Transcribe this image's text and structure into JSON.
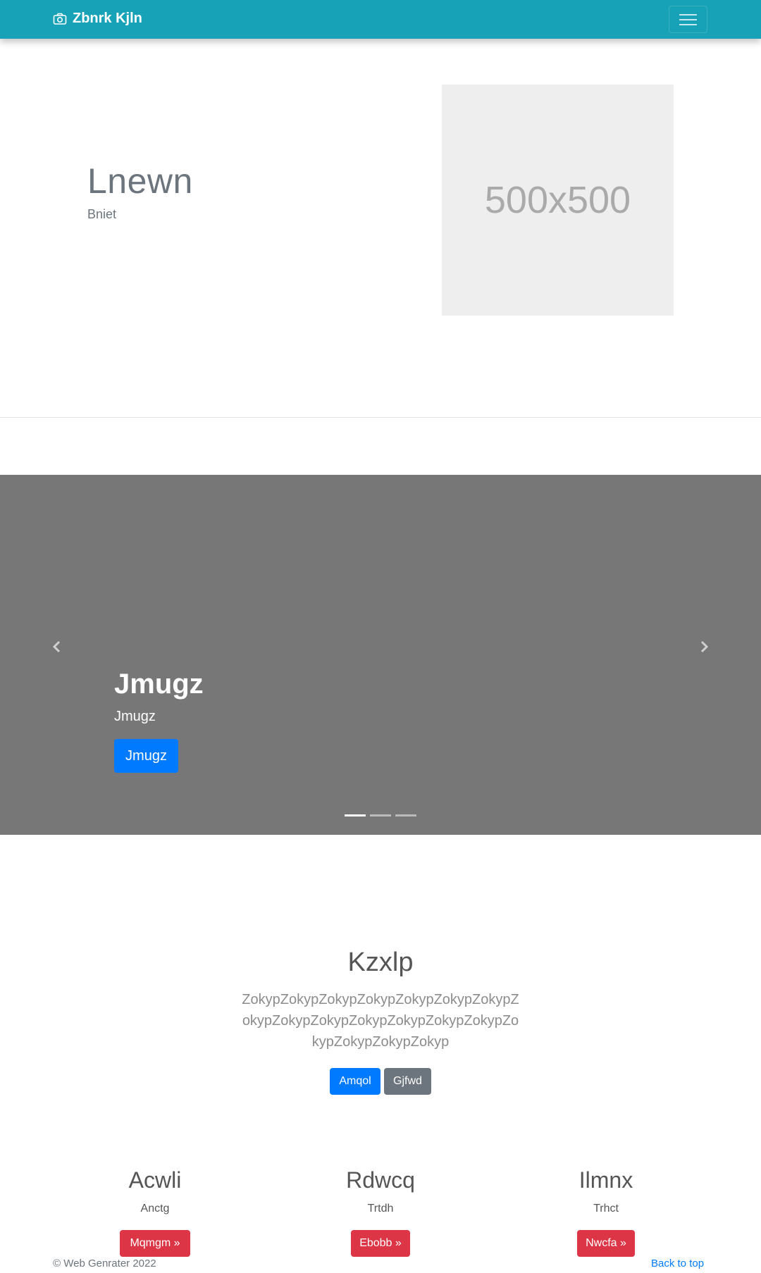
{
  "navbar": {
    "brand": "Zbnrk Kjln",
    "brand_icon": "camera-icon",
    "toggler_icon": "hamburger-menu-icon",
    "background": "#17a2b8"
  },
  "hero": {
    "title": "Lnewn",
    "subtitle": "Bniet",
    "image_placeholder": "500x500"
  },
  "carousel": {
    "background": "#777777",
    "prev_icon": "chevron-left-icon",
    "next_icon": "chevron-right-icon",
    "caption": {
      "title": "Jmugz",
      "text": "Jmugz",
      "button": "Jmugz"
    },
    "indicators": 3,
    "active_index": 0
  },
  "feature": {
    "title": "Kzxlp",
    "body": "ZokypZokypZokypZokypZokypZokypZokypZokypZokypZokypZokypZokypZokypZokypZokypZokypZokypZokyp",
    "primary_button": "Amqol",
    "secondary_button": "Gjfwd"
  },
  "columns": [
    {
      "title": "Acwli",
      "subtitle": "Anctg",
      "button": "Mqmgm »"
    },
    {
      "title": "Rdwcq",
      "subtitle": "Trtdh",
      "button": "Ebobb »"
    },
    {
      "title": "Ilmnx",
      "subtitle": "Trhct",
      "button": "Nwcfa »"
    }
  ],
  "footer": {
    "copyright": "© Web Genrater 2022",
    "back_to_top": "Back to top"
  }
}
